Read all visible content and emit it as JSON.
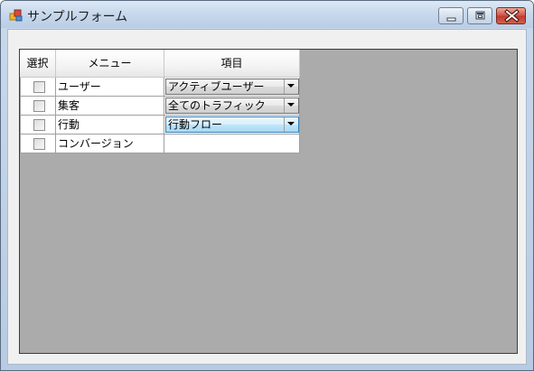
{
  "window": {
    "title": "サンプルフォーム",
    "icons": {
      "app": "app-form-icon",
      "minimize": "minimize-icon",
      "maximize": "maximize-icon",
      "close": "close-icon"
    }
  },
  "grid": {
    "headers": [
      "選択",
      "メニュー",
      "項目"
    ],
    "rows": [
      {
        "checked": false,
        "menu": "ユーザー",
        "item": "アクティブユーザー",
        "has_combo": true,
        "combo_active": false
      },
      {
        "checked": false,
        "menu": "集客",
        "item": "全てのトラフィック",
        "has_combo": true,
        "combo_active": false
      },
      {
        "checked": false,
        "menu": "行動",
        "item": "行動フロー",
        "has_combo": true,
        "combo_active": true
      },
      {
        "checked": false,
        "menu": "コンバージョン",
        "item": "",
        "has_combo": false,
        "combo_active": false
      }
    ],
    "dropdown_icon": "chevron-down-icon"
  },
  "colors": {
    "grid_background": "#ababab",
    "client_background": "#f0f0f0",
    "close_button": "#c8443a",
    "active_combo": "#bee6fd"
  }
}
